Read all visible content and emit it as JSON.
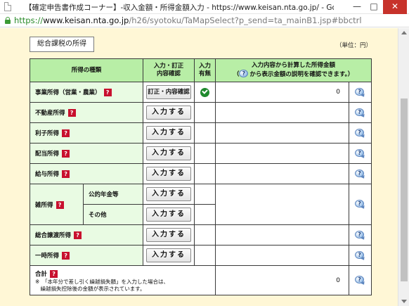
{
  "window": {
    "title": "【確定申告書作成コーナー】-収入金額・所得金額入力 - https://www.keisan.nta.go.jp/ - Google Chrome",
    "min_glyph": "—",
    "max_glyph": "□",
    "close_glyph": "✕"
  },
  "address": {
    "scheme": "https://",
    "host": "www.keisan.nta.go.jp",
    "path": "/h26/syotoku/TaMapSelect?p_send=ta_mainB1.jsp#bbctrl"
  },
  "page": {
    "section_label": "総合課税の所得",
    "unit_label": "（単位：円）",
    "headers": {
      "type": "所得の種類",
      "input_line1": "入力・訂正",
      "input_line2": "内容確認",
      "status_line1": "入力",
      "status_line2": "有無",
      "amount_line1": "入力内容から計算した所得金額",
      "amount_line2_pre": "（",
      "amount_line2_post": "から表示金額の説明を確認できます。）"
    },
    "help_glyph": "?",
    "q_glyph": "?",
    "rows": {
      "business": {
        "label": "事業所得（営業・農業）",
        "button": "訂正・内容確認",
        "status": "entered",
        "amount": "0"
      },
      "real_estate": {
        "label": "不動産所得",
        "button": "入力する",
        "amount": ""
      },
      "interest": {
        "label": "利子所得",
        "button": "入力する",
        "amount": ""
      },
      "dividend": {
        "label": "配当所得",
        "button": "入力する",
        "amount": ""
      },
      "salary": {
        "label": "給与所得",
        "button": "入力する",
        "amount": ""
      },
      "misc": {
        "label": "雑所得",
        "pension": {
          "label": "公的年金等",
          "button": "入力する"
        },
        "other": {
          "label": "その他",
          "button": "入力する"
        },
        "amount": ""
      },
      "capital_transfer": {
        "label": "総合譲渡所得",
        "button": "入力する",
        "amount": ""
      },
      "temporary": {
        "label": "一時所得",
        "button": "入力する",
        "amount": ""
      },
      "total": {
        "label": "合計",
        "note_line1": "※　「本年分で差し引く繰越損失額」を入力した場合は、",
        "note_line2": "　繰越損失控除後の金額が表示されています。",
        "amount": "0"
      }
    }
  },
  "colors": {
    "page_bg": "#fff7d6",
    "header_bg": "#b8eea6",
    "name_bg": "#e9fbe3",
    "help_red": "#c8102e",
    "check_green": "#1f8a2e"
  },
  "icons": {
    "help": "help-icon",
    "explain": "question-bubble-icon",
    "entered": "checkmark-icon"
  }
}
